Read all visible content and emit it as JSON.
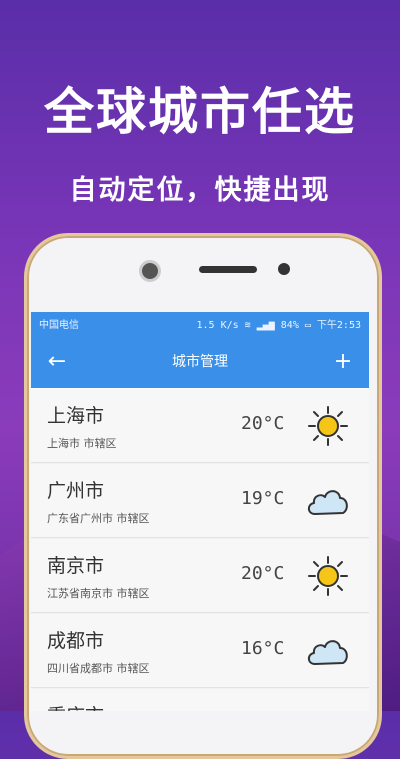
{
  "promo": {
    "headline": "全球城市任选",
    "subline": "自动定位，快捷出现"
  },
  "statusbar": {
    "carrier": "中国电信",
    "right": "1.5 K/s ≋ ▂▄▆ 84% ▭ 下午2:53"
  },
  "appbar": {
    "back": "←",
    "title": "城市管理",
    "add": "+"
  },
  "cities": [
    {
      "name": "上海市",
      "region": "上海市  市辖区",
      "temp": "20°C",
      "icon": "sun-icon"
    },
    {
      "name": "广州市",
      "region": "广东省广州市  市辖区",
      "temp": "19°C",
      "icon": "cloud-icon"
    },
    {
      "name": "南京市",
      "region": "江苏省南京市  市辖区",
      "temp": "20°C",
      "icon": "sun-icon"
    },
    {
      "name": "成都市",
      "region": "四川省成都市  市辖区",
      "temp": "16°C",
      "icon": "cloud-icon"
    },
    {
      "name": "重庆市",
      "region": "",
      "temp": "",
      "icon": "sun-icon"
    }
  ],
  "colors": {
    "accent": "#3a8fe8",
    "sun": "#f5c518"
  }
}
